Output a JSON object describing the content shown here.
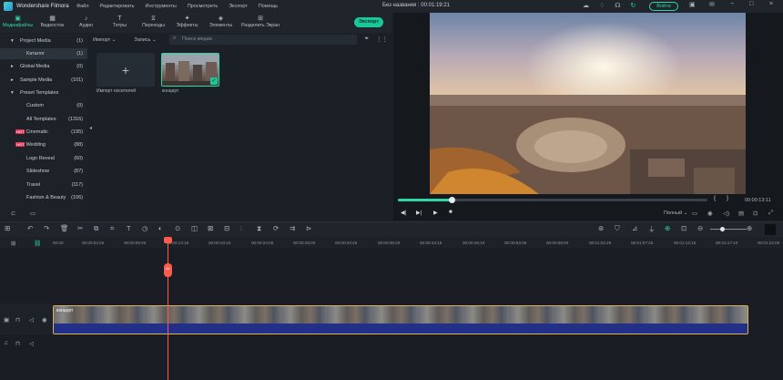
{
  "app": {
    "name": "Wondershare Filmora",
    "document_title": "Без названия : 00:01:19:21"
  },
  "menu": [
    "Файл",
    "Редактировать",
    "Инструменты",
    "Просмотреть",
    "Экспорт",
    "Помощь"
  ],
  "titlebar": {
    "login_label": "Войти"
  },
  "tabs": [
    {
      "label": "Медиафайлы",
      "icon": "folder-icon"
    },
    {
      "label": "Видеосток",
      "icon": "stock-icon"
    },
    {
      "label": "Аудио",
      "icon": "music-icon"
    },
    {
      "label": "Титры",
      "icon": "text-icon"
    },
    {
      "label": "Переходы",
      "icon": "transition-icon"
    },
    {
      "label": "Эффекты",
      "icon": "effects-icon"
    },
    {
      "label": "Элементы",
      "icon": "elements-icon"
    },
    {
      "label": "Разделить Экран",
      "icon": "split-screen-icon"
    }
  ],
  "export_label": "Экспорт",
  "sidebar": {
    "items": [
      {
        "label": "Project Media",
        "count": "(1)"
      },
      {
        "label": "Каталог",
        "count": "(1)"
      },
      {
        "label": "Global Media",
        "count": "(0)"
      },
      {
        "label": "Sample Media",
        "count": "(101)"
      },
      {
        "label": "Preset Templates",
        "count": ""
      },
      {
        "label": "Custom",
        "count": "(0)"
      },
      {
        "label": "All Templates",
        "count": "(1316)"
      },
      {
        "label": "Cinematic",
        "count": "(195)"
      },
      {
        "label": "Wedding",
        "count": "(88)"
      },
      {
        "label": "Logo Reveal",
        "count": "(60)"
      },
      {
        "label": "Slideshow",
        "count": "(87)"
      },
      {
        "label": "Travel",
        "count": "(117)"
      },
      {
        "label": "Fashion & Beauty",
        "count": "(106)"
      }
    ],
    "hot_badge": "HOT"
  },
  "media": {
    "filter_import": "Импорт",
    "filter_record": "Запись",
    "search_placeholder": "Поиск медиа",
    "import_caption": "Импорт носителей",
    "clip_caption": "концерт"
  },
  "preview": {
    "time": "00:00:13:11",
    "quality": "Полный"
  },
  "ruler": [
    "00:00",
    "00:00:04:25",
    "00:00:09:20",
    "00:00:14:15",
    "00:00:19:10",
    "00:00:24:05",
    "00:00:29:00",
    "00:00:33:25",
    "00:00:38:20",
    "00:00:43:15",
    "00:00:48:10",
    "00:00:53:05",
    "00:00:58:00",
    "00:01:02:25",
    "00:01:07:20",
    "00:01:12:15",
    "00:01:17:10",
    "00:01:22:05"
  ],
  "clip": {
    "name": "концерт"
  },
  "colors": {
    "accent": "#2fd6a6",
    "playhead": "#ff5a4e",
    "clip_border": "#d9b35a"
  }
}
